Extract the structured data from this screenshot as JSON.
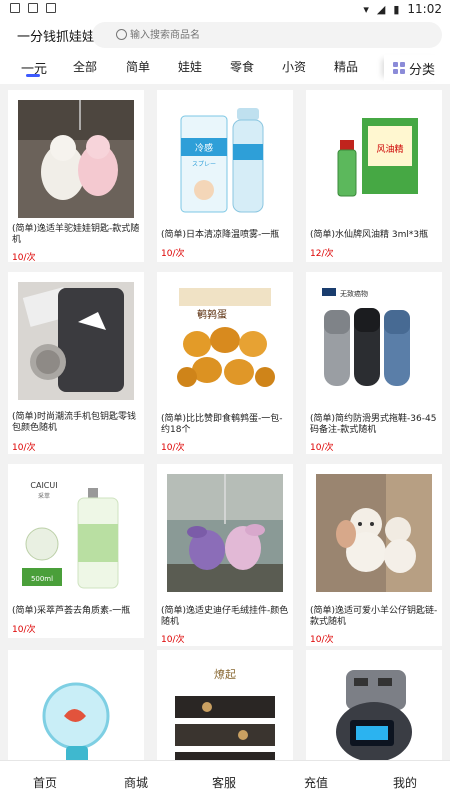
{
  "status": {
    "time": "11:02"
  },
  "header": {
    "title": "一分钱抓娃娃",
    "search_placeholder": "输入搜索商品名"
  },
  "tabs": [
    "一元",
    "全部",
    "简单",
    "娃娃",
    "零食",
    "小资",
    "精品"
  ],
  "category_label": "分类",
  "products": [
    {
      "name": "(简单)逸适羊驼娃娃钥匙-款式随机",
      "price": "10/次"
    },
    {
      "name": "(简单)日本清凉降温喷雾-一瓶",
      "price": "10/次"
    },
    {
      "name": "(简单)水仙牌风油精 3ml*3瓶",
      "price": "12/次"
    },
    {
      "name": "(简单)时尚潮流手机包钥匙零钱包颜色随机",
      "price": "10/次"
    },
    {
      "name": "(简单)比比赞即食鹌鹑蛋-一包-约18个",
      "price": "10/次"
    },
    {
      "name": "(简单)简约防滑男式拖鞋-36-45码备注-款式随机",
      "price": "10/次"
    },
    {
      "name": "(简单)采萃芦荟去角质素-一瓶",
      "price": "10/次"
    },
    {
      "name": "(简单)逸适史迪仔毛绒挂件-颜色随机",
      "price": "10/次"
    },
    {
      "name": "(简单)逸适可爱小羊公仔钥匙链-款式随机",
      "price": "10/次"
    },
    {
      "name": "",
      "price": ""
    },
    {
      "name": "",
      "price": ""
    },
    {
      "name": "",
      "price": ""
    }
  ],
  "image_text": {
    "spray": "冷感",
    "spray2": "スプレー",
    "oil": "风油精",
    "eggs": "鹌鹑蛋",
    "slipper_tag": "无致癌物",
    "caicui": "CAICUI",
    "caicui_cn": "采萃",
    "ml": "500ml",
    "brand_box": "燎起"
  },
  "tabbar": [
    "首页",
    "商城",
    "客服",
    "充值",
    "我的"
  ]
}
